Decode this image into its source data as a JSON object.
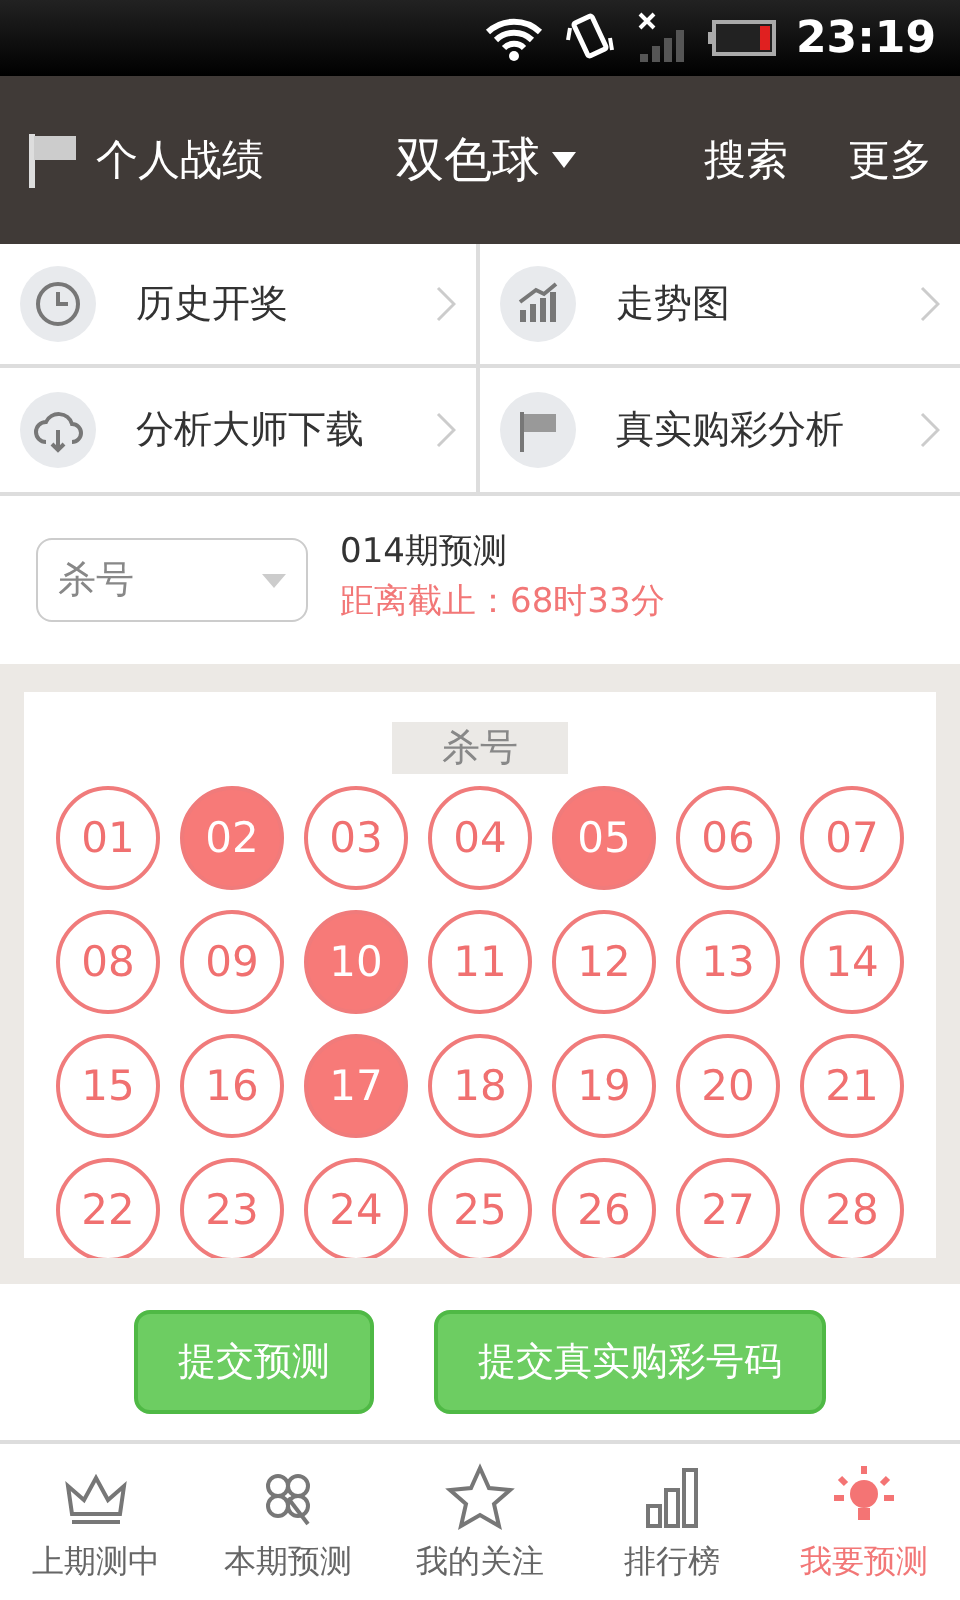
{
  "status_bar": {
    "time": "23:19"
  },
  "header": {
    "left": "个人战绩",
    "title": "双色球",
    "actions": [
      "搜索",
      "更多"
    ]
  },
  "menu": [
    {
      "kind": "clock",
      "label": "历史开奖"
    },
    {
      "kind": "chart",
      "label": "走势图"
    },
    {
      "kind": "download",
      "label": "分析大师下载"
    },
    {
      "kind": "flag",
      "label": "真实购彩分析"
    }
  ],
  "prediction": {
    "mode_select": "杀号",
    "period": "014期预测",
    "deadline": "距离截止：68时33分"
  },
  "panel": {
    "tag": "杀号",
    "balls": [
      {
        "label": "01",
        "selected": false
      },
      {
        "label": "02",
        "selected": true
      },
      {
        "label": "03",
        "selected": false
      },
      {
        "label": "04",
        "selected": false
      },
      {
        "label": "05",
        "selected": true
      },
      {
        "label": "06",
        "selected": false
      },
      {
        "label": "07",
        "selected": false
      },
      {
        "label": "08",
        "selected": false
      },
      {
        "label": "09",
        "selected": false
      },
      {
        "label": "10",
        "selected": true
      },
      {
        "label": "11",
        "selected": false
      },
      {
        "label": "12",
        "selected": false
      },
      {
        "label": "13",
        "selected": false
      },
      {
        "label": "14",
        "selected": false
      },
      {
        "label": "15",
        "selected": false
      },
      {
        "label": "16",
        "selected": false
      },
      {
        "label": "17",
        "selected": true
      },
      {
        "label": "18",
        "selected": false
      },
      {
        "label": "19",
        "selected": false
      },
      {
        "label": "20",
        "selected": false
      },
      {
        "label": "21",
        "selected": false
      },
      {
        "label": "22",
        "selected": false
      },
      {
        "label": "23",
        "selected": false
      },
      {
        "label": "24",
        "selected": false
      },
      {
        "label": "25",
        "selected": false
      },
      {
        "label": "26",
        "selected": false
      },
      {
        "label": "27",
        "selected": false
      },
      {
        "label": "28",
        "selected": false
      }
    ]
  },
  "buttons": [
    "提交预测",
    "提交真实购彩号码"
  ],
  "nav": [
    {
      "kind": "crown",
      "label": "上期测中",
      "selected": false
    },
    {
      "kind": "clover",
      "label": "本期预测",
      "selected": false
    },
    {
      "kind": "star",
      "label": "我的关注",
      "selected": false
    },
    {
      "kind": "bars",
      "label": "排行榜",
      "selected": false
    },
    {
      "kind": "bulb",
      "label": "我要预测",
      "selected": true
    }
  ]
}
